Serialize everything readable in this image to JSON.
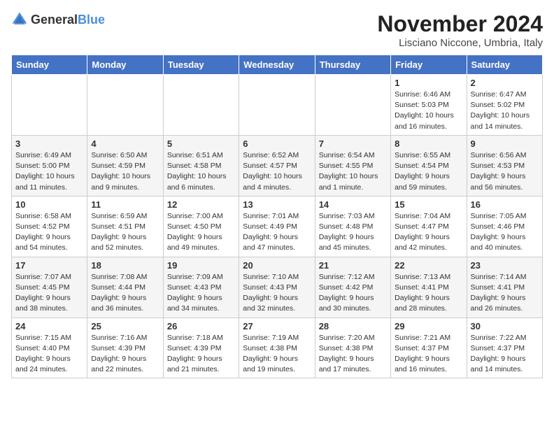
{
  "logo": {
    "general": "General",
    "blue": "Blue"
  },
  "title": "November 2024",
  "location": "Lisciano Niccone, Umbria, Italy",
  "headers": [
    "Sunday",
    "Monday",
    "Tuesday",
    "Wednesday",
    "Thursday",
    "Friday",
    "Saturday"
  ],
  "weeks": [
    [
      {
        "day": "",
        "info": ""
      },
      {
        "day": "",
        "info": ""
      },
      {
        "day": "",
        "info": ""
      },
      {
        "day": "",
        "info": ""
      },
      {
        "day": "",
        "info": ""
      },
      {
        "day": "1",
        "info": "Sunrise: 6:46 AM\nSunset: 5:03 PM\nDaylight: 10 hours and 16 minutes."
      },
      {
        "day": "2",
        "info": "Sunrise: 6:47 AM\nSunset: 5:02 PM\nDaylight: 10 hours and 14 minutes."
      }
    ],
    [
      {
        "day": "3",
        "info": "Sunrise: 6:49 AM\nSunset: 5:00 PM\nDaylight: 10 hours and 11 minutes."
      },
      {
        "day": "4",
        "info": "Sunrise: 6:50 AM\nSunset: 4:59 PM\nDaylight: 10 hours and 9 minutes."
      },
      {
        "day": "5",
        "info": "Sunrise: 6:51 AM\nSunset: 4:58 PM\nDaylight: 10 hours and 6 minutes."
      },
      {
        "day": "6",
        "info": "Sunrise: 6:52 AM\nSunset: 4:57 PM\nDaylight: 10 hours and 4 minutes."
      },
      {
        "day": "7",
        "info": "Sunrise: 6:54 AM\nSunset: 4:55 PM\nDaylight: 10 hours and 1 minute."
      },
      {
        "day": "8",
        "info": "Sunrise: 6:55 AM\nSunset: 4:54 PM\nDaylight: 9 hours and 59 minutes."
      },
      {
        "day": "9",
        "info": "Sunrise: 6:56 AM\nSunset: 4:53 PM\nDaylight: 9 hours and 56 minutes."
      }
    ],
    [
      {
        "day": "10",
        "info": "Sunrise: 6:58 AM\nSunset: 4:52 PM\nDaylight: 9 hours and 54 minutes."
      },
      {
        "day": "11",
        "info": "Sunrise: 6:59 AM\nSunset: 4:51 PM\nDaylight: 9 hours and 52 minutes."
      },
      {
        "day": "12",
        "info": "Sunrise: 7:00 AM\nSunset: 4:50 PM\nDaylight: 9 hours and 49 minutes."
      },
      {
        "day": "13",
        "info": "Sunrise: 7:01 AM\nSunset: 4:49 PM\nDaylight: 9 hours and 47 minutes."
      },
      {
        "day": "14",
        "info": "Sunrise: 7:03 AM\nSunset: 4:48 PM\nDaylight: 9 hours and 45 minutes."
      },
      {
        "day": "15",
        "info": "Sunrise: 7:04 AM\nSunset: 4:47 PM\nDaylight: 9 hours and 42 minutes."
      },
      {
        "day": "16",
        "info": "Sunrise: 7:05 AM\nSunset: 4:46 PM\nDaylight: 9 hours and 40 minutes."
      }
    ],
    [
      {
        "day": "17",
        "info": "Sunrise: 7:07 AM\nSunset: 4:45 PM\nDaylight: 9 hours and 38 minutes."
      },
      {
        "day": "18",
        "info": "Sunrise: 7:08 AM\nSunset: 4:44 PM\nDaylight: 9 hours and 36 minutes."
      },
      {
        "day": "19",
        "info": "Sunrise: 7:09 AM\nSunset: 4:43 PM\nDaylight: 9 hours and 34 minutes."
      },
      {
        "day": "20",
        "info": "Sunrise: 7:10 AM\nSunset: 4:43 PM\nDaylight: 9 hours and 32 minutes."
      },
      {
        "day": "21",
        "info": "Sunrise: 7:12 AM\nSunset: 4:42 PM\nDaylight: 9 hours and 30 minutes."
      },
      {
        "day": "22",
        "info": "Sunrise: 7:13 AM\nSunset: 4:41 PM\nDaylight: 9 hours and 28 minutes."
      },
      {
        "day": "23",
        "info": "Sunrise: 7:14 AM\nSunset: 4:41 PM\nDaylight: 9 hours and 26 minutes."
      }
    ],
    [
      {
        "day": "24",
        "info": "Sunrise: 7:15 AM\nSunset: 4:40 PM\nDaylight: 9 hours and 24 minutes."
      },
      {
        "day": "25",
        "info": "Sunrise: 7:16 AM\nSunset: 4:39 PM\nDaylight: 9 hours and 22 minutes."
      },
      {
        "day": "26",
        "info": "Sunrise: 7:18 AM\nSunset: 4:39 PM\nDaylight: 9 hours and 21 minutes."
      },
      {
        "day": "27",
        "info": "Sunrise: 7:19 AM\nSunset: 4:38 PM\nDaylight: 9 hours and 19 minutes."
      },
      {
        "day": "28",
        "info": "Sunrise: 7:20 AM\nSunset: 4:38 PM\nDaylight: 9 hours and 17 minutes."
      },
      {
        "day": "29",
        "info": "Sunrise: 7:21 AM\nSunset: 4:37 PM\nDaylight: 9 hours and 16 minutes."
      },
      {
        "day": "30",
        "info": "Sunrise: 7:22 AM\nSunset: 4:37 PM\nDaylight: 9 hours and 14 minutes."
      }
    ]
  ]
}
